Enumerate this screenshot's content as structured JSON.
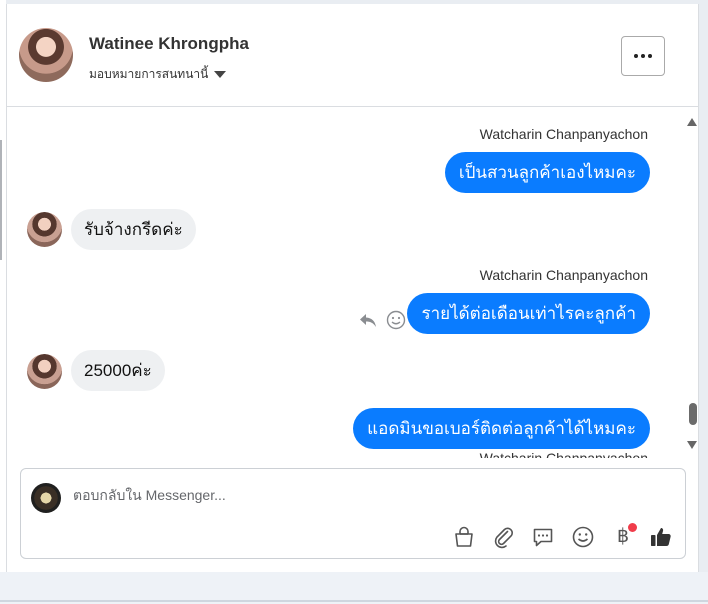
{
  "header": {
    "contact_name": "Watinee Khrongpha",
    "assign_label": "มอบหมายการสนทนานี้"
  },
  "messages": [
    {
      "direction": "out",
      "sender": "Watcharin Chanpanyachon",
      "text": "เป็นสวนลูกค้าเองไหมคะ"
    },
    {
      "direction": "in",
      "text": "รับจ้างกรีดค่ะ"
    },
    {
      "direction": "out",
      "sender": "Watcharin Chanpanyachon",
      "text": "รายได้ต่อเดือนเท่าไรคะลูกค้า"
    },
    {
      "direction": "in",
      "text": "25000ค่ะ"
    },
    {
      "direction": "out",
      "sender": "Watcharin Chanpanyachon",
      "text": "แอดมินขอเบอร์ติดต่อลูกค้าได้ไหมคะ"
    }
  ],
  "composer": {
    "placeholder": "ตอบกลับใน Messenger...",
    "tools": [
      "shop-bag-icon",
      "attachment-icon",
      "saved-replies-icon",
      "emoji-icon",
      "baht-payment-icon",
      "thumbs-up-icon"
    ],
    "baht_symbol": "฿"
  },
  "colors": {
    "outgoing_bubble": "#0a7cff",
    "incoming_bubble": "#eef0f2",
    "notification_dot": "#f03c4a"
  }
}
